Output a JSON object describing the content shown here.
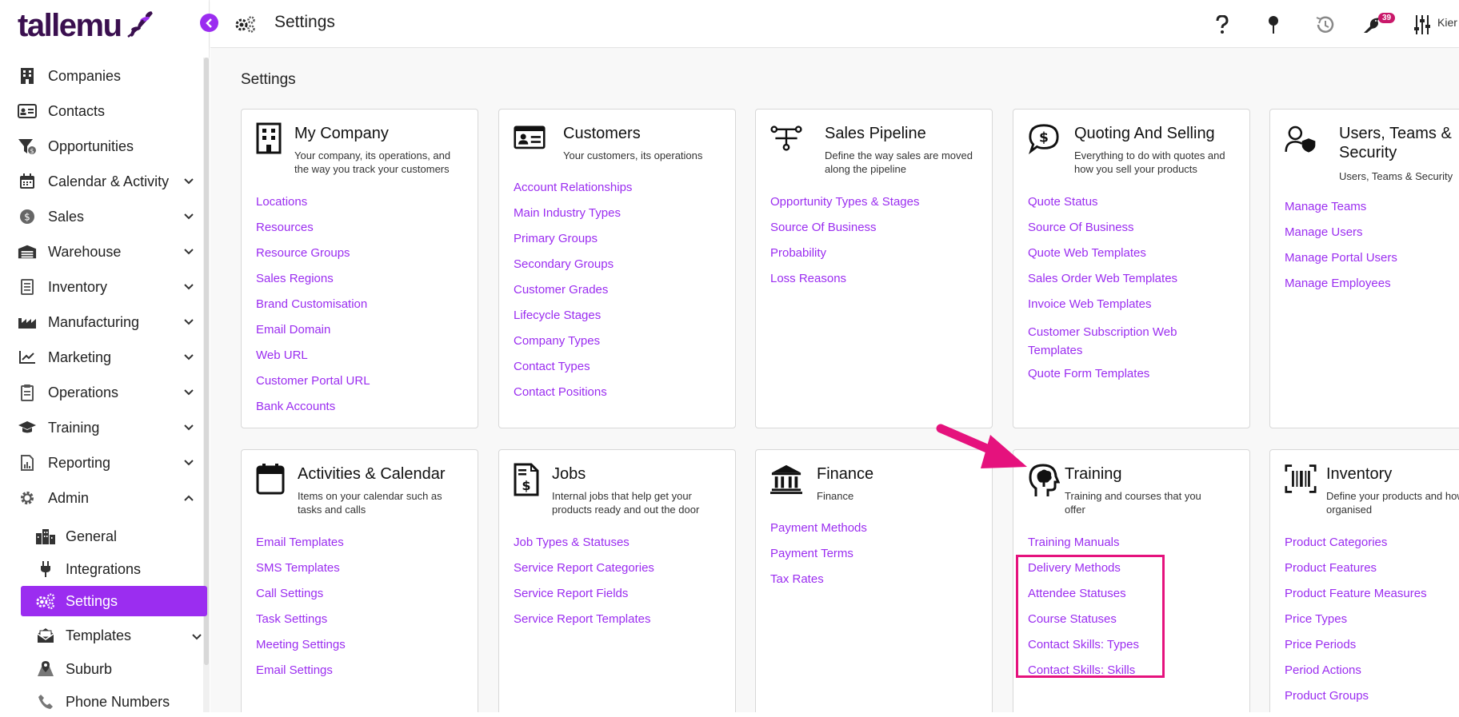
{
  "app": {
    "logo_text": "tallemu",
    "title": "Settings",
    "notifications_count": "39",
    "user_name_truncated": "Kier"
  },
  "sidebar": {
    "items": [
      {
        "label": "Companies",
        "icon": "building-icon",
        "chevron": false
      },
      {
        "label": "Contacts",
        "icon": "contact-card-icon",
        "chevron": false
      },
      {
        "label": "Opportunities",
        "icon": "funnel-dollar-icon",
        "chevron": false
      },
      {
        "label": "Calendar & Activity",
        "icon": "calendar-icon",
        "chevron": true
      },
      {
        "label": "Sales",
        "icon": "dollar-coin-icon",
        "chevron": true
      },
      {
        "label": "Warehouse",
        "icon": "warehouse-icon",
        "chevron": true
      },
      {
        "label": "Inventory",
        "icon": "inventory-list-icon",
        "chevron": true
      },
      {
        "label": "Manufacturing",
        "icon": "factory-icon",
        "chevron": true
      },
      {
        "label": "Marketing",
        "icon": "trend-chart-icon",
        "chevron": true
      },
      {
        "label": "Operations",
        "icon": "clipboard-icon",
        "chevron": true
      },
      {
        "label": "Training",
        "icon": "graduation-cap-icon",
        "chevron": true
      },
      {
        "label": "Reporting",
        "icon": "report-icon",
        "chevron": true
      },
      {
        "label": "Admin",
        "icon": "gear-icon",
        "chevron": true,
        "expanded": true
      }
    ],
    "admin_sub": [
      {
        "label": "General",
        "icon": "city-icon"
      },
      {
        "label": "Integrations",
        "icon": "plug-icon"
      },
      {
        "label": "Settings",
        "icon": "gears-icon",
        "active": true
      },
      {
        "label": "Templates",
        "icon": "envelope-open-icon",
        "chevron": true
      },
      {
        "label": "Suburb",
        "icon": "map-pin-icon"
      },
      {
        "label": "Phone Numbers",
        "icon": "phone-icon"
      }
    ]
  },
  "main": {
    "heading": "Settings",
    "cards": [
      {
        "title": "My Company",
        "desc": "Your company, its operations, and the way you track your customers",
        "icon": "building-icon",
        "links": [
          "Locations",
          "Resources",
          "Resource Groups",
          "Sales Regions",
          "Brand Customisation",
          "Email Domain",
          "Web URL",
          "Customer Portal URL",
          "Bank Accounts"
        ]
      },
      {
        "title": "Customers",
        "desc": "Your customers, its operations",
        "icon": "id-card-icon",
        "links": [
          "Account Relationships",
          "Main Industry Types",
          "Primary Groups",
          "Secondary Groups",
          "Customer Grades",
          "Lifecycle Stages",
          "Company Types",
          "Contact Types",
          "Contact Positions"
        ]
      },
      {
        "title": "Sales Pipeline",
        "desc": "Define the way sales are moved along the pipeline",
        "icon": "pipeline-icon",
        "links": [
          "Opportunity Types & Stages",
          "Source Of Business",
          "Probability",
          "Loss Reasons"
        ]
      },
      {
        "title": "Quoting And Selling",
        "desc": "Everything to do with quotes and how you sell your products",
        "icon": "dollar-speech-icon",
        "links": [
          "Quote Status",
          "Source Of Business",
          "Quote Web Templates",
          "Sales Order Web Templates",
          "Invoice Web Templates",
          "Customer Subscription Web Templates",
          "Quote Form Templates"
        ]
      },
      {
        "title": "Users, Teams & Security",
        "desc": "Users, Teams & Security",
        "icon": "user-shield-icon",
        "links": [
          "Manage Teams",
          "Manage Users",
          "Manage Portal Users",
          "Manage Employees"
        ]
      },
      {
        "title": "Activities & Calendar",
        "desc": "Items on your calendar such as tasks and calls",
        "icon": "calendar-icon",
        "links": [
          "Email Templates",
          "SMS Templates",
          "Call Settings",
          "Task Settings",
          "Meeting Settings",
          "Email Settings"
        ]
      },
      {
        "title": "Jobs",
        "desc": "Internal jobs that help get your products ready and out the door",
        "icon": "invoice-dollar-icon",
        "links": [
          "Job Types & Statuses",
          "Service Report Categories",
          "Service Report Fields",
          "Service Report Templates"
        ]
      },
      {
        "title": "Finance",
        "desc": "Finance",
        "icon": "bank-icon",
        "links": [
          "Payment Methods",
          "Payment Terms",
          "Tax Rates"
        ]
      },
      {
        "title": "Training",
        "desc": "Training and courses that you offer",
        "icon": "head-brain-icon",
        "links": [
          "Training Manuals",
          "Delivery Methods",
          "Attendee Statuses",
          "Course Statuses",
          "Contact Skills: Types",
          "Contact Skills: Skills"
        ]
      },
      {
        "title": "Inventory",
        "desc": "Define your products and how they are organised",
        "icon": "barcode-icon",
        "links": [
          "Product Categories",
          "Product Features",
          "Product Feature Measures",
          "Price Types",
          "Price Periods",
          "Period Actions",
          "Product Groups"
        ]
      }
    ]
  },
  "colors": {
    "accent": "#9b2df0",
    "highlight": "#e5127d",
    "badge": "#c9186a",
    "logo": "#3a0f4f"
  }
}
